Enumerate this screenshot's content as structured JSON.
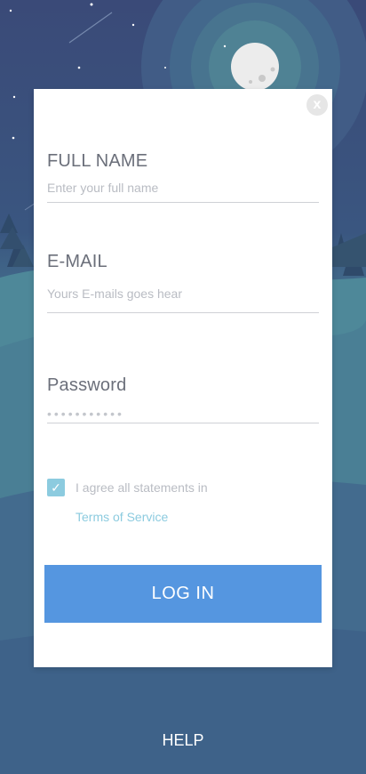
{
  "form": {
    "full_name": {
      "label": "FULL NAME",
      "placeholder": "Enter your full name"
    },
    "email": {
      "label": "E-MAIL",
      "placeholder": "Yours E-mails goes hear"
    },
    "password": {
      "label": "Password",
      "value": "•••••••••••"
    },
    "agree": {
      "checked": true,
      "check_glyph": "✓",
      "text": "I agree all statements in",
      "link_text": "Terms of Service"
    },
    "login_label": "LOG IN",
    "close_glyph": "x"
  },
  "help_label": "HELP",
  "icons": {
    "close": "close-icon",
    "check": "check-icon"
  },
  "colors": {
    "accent_blue": "#5596e0",
    "checkbox_teal": "#8ccbdf",
    "label_gray": "#6b6f7a",
    "placeholder_gray": "#b9bcc3",
    "night_sky": "#3a4a78",
    "moon": "#ececec"
  }
}
